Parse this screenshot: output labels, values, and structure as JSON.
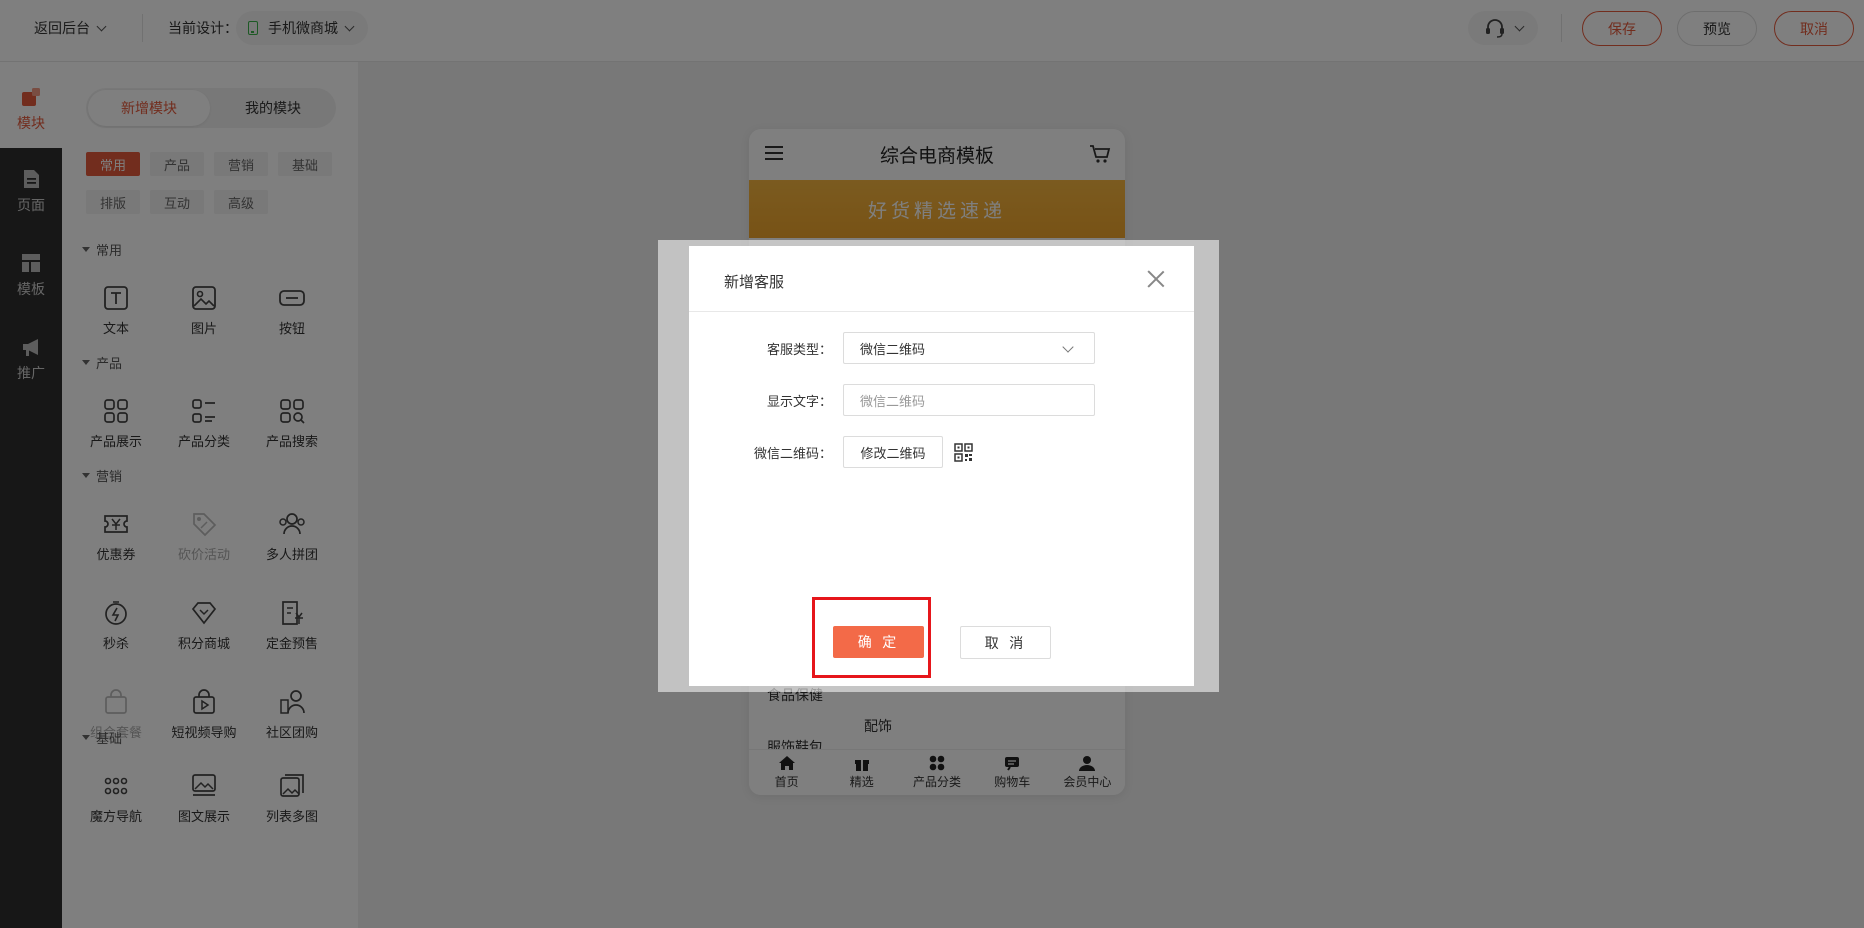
{
  "topbar": {
    "back_label": "返回后台",
    "current_design_label": "当前设计：",
    "design_name": "手机微商城",
    "save_label": "保存",
    "preview_label": "预览",
    "cancel_label": "取消"
  },
  "rail": {
    "items": [
      {
        "label": "模块",
        "icon": "module-icon"
      },
      {
        "label": "页面",
        "icon": "page-icon"
      },
      {
        "label": "模板",
        "icon": "template-icon"
      },
      {
        "label": "推广",
        "icon": "megaphone-icon"
      }
    ]
  },
  "panel": {
    "tabs": [
      "新增模块",
      "我的模块"
    ],
    "chips": [
      "常用",
      "产品",
      "营销",
      "基础",
      "排版",
      "互动",
      "高级"
    ],
    "sections": {
      "common": {
        "title": "常用",
        "items": [
          "文本",
          "图片",
          "按钮"
        ]
      },
      "product": {
        "title": "产品",
        "items": [
          "产品展示",
          "产品分类",
          "产品搜索"
        ]
      },
      "marketing": {
        "title": "营销",
        "items": [
          "优惠券",
          "砍价活动",
          "多人拼团",
          "秒杀",
          "积分商城",
          "定金预售",
          "组合套餐",
          "短视频导购",
          "社区团购"
        ]
      },
      "basic": {
        "title": "基础",
        "items": [
          "魔方导航",
          "图文展示",
          "列表多图"
        ]
      }
    }
  },
  "phone": {
    "title": "综合电商模板",
    "banner_text": "好货精选速递",
    "side_items": [
      "食品保健",
      "服饰鞋包"
    ],
    "sub_item": "配饰",
    "tabs": [
      "首页",
      "精选",
      "产品分类",
      "购物车",
      "会员中心"
    ]
  },
  "modal": {
    "title": "新增客服",
    "type_label": "客服类型：",
    "type_value": "微信二维码",
    "text_label": "显示文字：",
    "text_placeholder": "微信二维码",
    "qr_label": "微信二维码：",
    "qr_button": "修改二维码",
    "ok_label": "确 定",
    "cancel_label": "取 消"
  },
  "colors": {
    "accent": "#e55a3c",
    "highlight_box": "#e6161b"
  }
}
